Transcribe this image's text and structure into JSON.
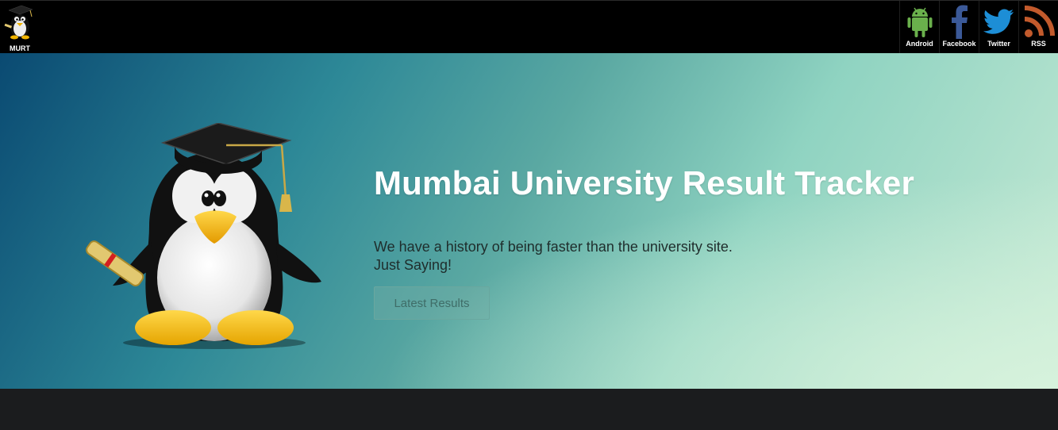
{
  "brand": {
    "label": "MURT",
    "icon": "penguin-graduate-icon"
  },
  "social": [
    {
      "label": "Android",
      "icon": "android-icon",
      "color": "#6ab04c"
    },
    {
      "label": "Facebook",
      "icon": "facebook-icon",
      "color": "#3b5998"
    },
    {
      "label": "Twitter",
      "icon": "twitter-icon",
      "color": "#1d8ed6"
    },
    {
      "label": "RSS",
      "icon": "rss-icon",
      "color": "#c25a2c"
    }
  ],
  "hero": {
    "title": "Mumbai University Result Tracker",
    "line1": "We have a history of being faster than the university site.",
    "line2": "Just Saying!",
    "button_label": "Latest Results"
  },
  "colors": {
    "topbar": "#000000",
    "hero_dark": "#0a4a72",
    "hero_light": "#d6f2dc",
    "footer": "#1b1c1e"
  }
}
